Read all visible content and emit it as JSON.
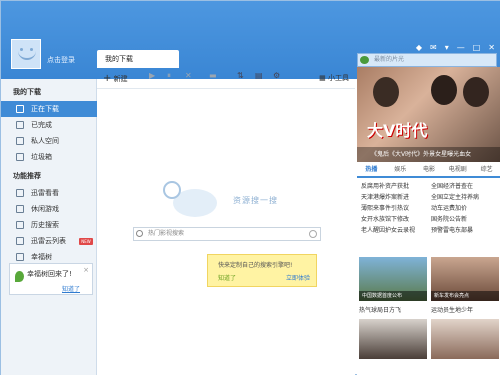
{
  "app": {
    "login_label": "点击登录",
    "main_tab": "我的下载"
  },
  "titlebar_icons": [
    "signal-icon",
    "skin-icon",
    "mail-icon",
    "menu-icon",
    "minimize-icon",
    "maximize-icon",
    "close-icon"
  ],
  "top_search": {
    "placeholder": "最新的片光"
  },
  "sidebar": {
    "section_downloads": "我的下载",
    "items": [
      {
        "label": "正在下载",
        "active": true
      },
      {
        "label": "已完成",
        "active": false
      },
      {
        "label": "私人空间",
        "active": false
      },
      {
        "label": "垃圾箱",
        "active": false
      }
    ],
    "section_features": "功能推荐",
    "features": [
      {
        "label": "迅雷看看"
      },
      {
        "label": "休闲游戏"
      },
      {
        "label": "历史搜索"
      },
      {
        "label": "迅雷云列表",
        "badge": "NEW"
      },
      {
        "label": "幸福树"
      }
    ],
    "popup": {
      "text": "幸福树回来了!",
      "link": "知道了"
    }
  },
  "toolbar": {
    "new_label": "新建",
    "tools_label": "小工具"
  },
  "content": {
    "brand": "资源搜一搜",
    "search_placeholder": "热门影视搜索",
    "tip_line1": "快来定制自己的搜索引擎吧!",
    "tip_link_left": "知道了",
    "tip_link_right": "立即体验"
  },
  "right_panel": {
    "hero_title": "大V时代",
    "hero_caption": "《鬼后《大V时代》外景女星曝光血女",
    "tabs": [
      {
        "label": "热播",
        "on": true
      },
      {
        "label": "娱乐",
        "on": false
      },
      {
        "label": "电影",
        "on": false
      },
      {
        "label": "电视剧",
        "on": false
      },
      {
        "label": "综艺",
        "on": false
      }
    ],
    "news": [
      [
        "反腐用补资产获批",
        "全国经济普查在"
      ],
      [
        "天津港爆炸案新进",
        "全国立定主持养病"
      ],
      [
        "薄熙来事件引热议",
        "动车运费加价"
      ],
      [
        "女开水族馆下修改",
        "国务院公告新"
      ],
      [
        "老人醒因护女云录视",
        "预警雷电东部暴"
      ]
    ],
    "thumbs": [
      {
        "cap": "中国数据首度公布",
        "label": "热气球局日方飞"
      },
      {
        "cap": "新车发布会亮点",
        "label": "运动员生地少年"
      }
    ]
  }
}
